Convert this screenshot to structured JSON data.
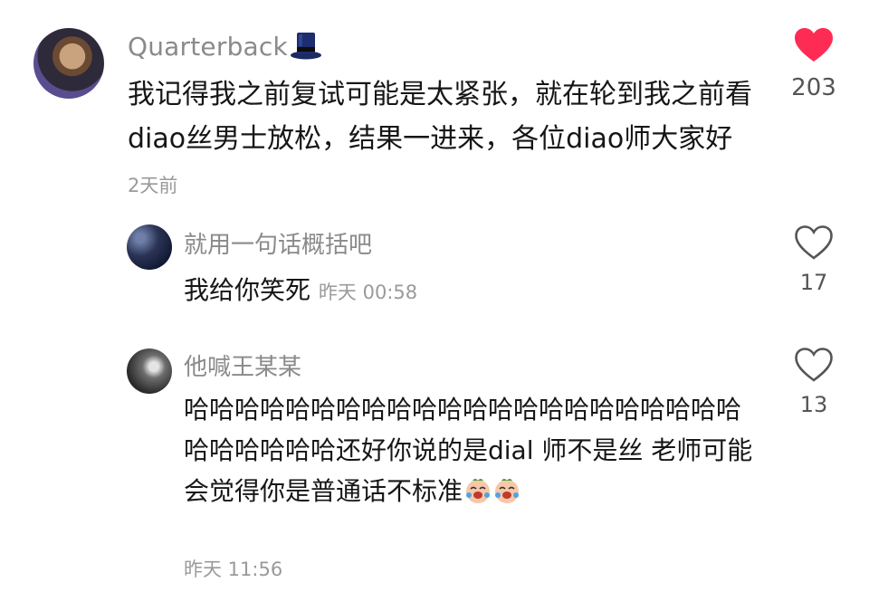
{
  "comments": [
    {
      "username": "Quarterback",
      "user_suffix_icon": "top-hat-icon",
      "text": "我记得我之前复试可能是太紧张，就在轮到我之前看diao丝男士放松，结果一进来，各位diao师大家好",
      "time": "2天前",
      "likes": "203",
      "liked": true,
      "like_color": "#fe2c55"
    },
    {
      "username": "就用一句话概括吧",
      "text": "我给你笑死",
      "time": "昨天 00:58",
      "likes": "17",
      "liked": false
    },
    {
      "username": "他喊王某某",
      "text": "哈哈哈哈哈哈哈哈哈哈哈哈哈哈哈哈哈哈哈哈哈哈哈哈哈哈哈哈还好你说的是dial 师不是丝 老师可能会觉得你是普通话不标准",
      "emojis": [
        "laughing-crying-emoji",
        "laughing-crying-emoji"
      ],
      "time": "昨天 11:56",
      "likes": "13",
      "liked": false
    }
  ]
}
